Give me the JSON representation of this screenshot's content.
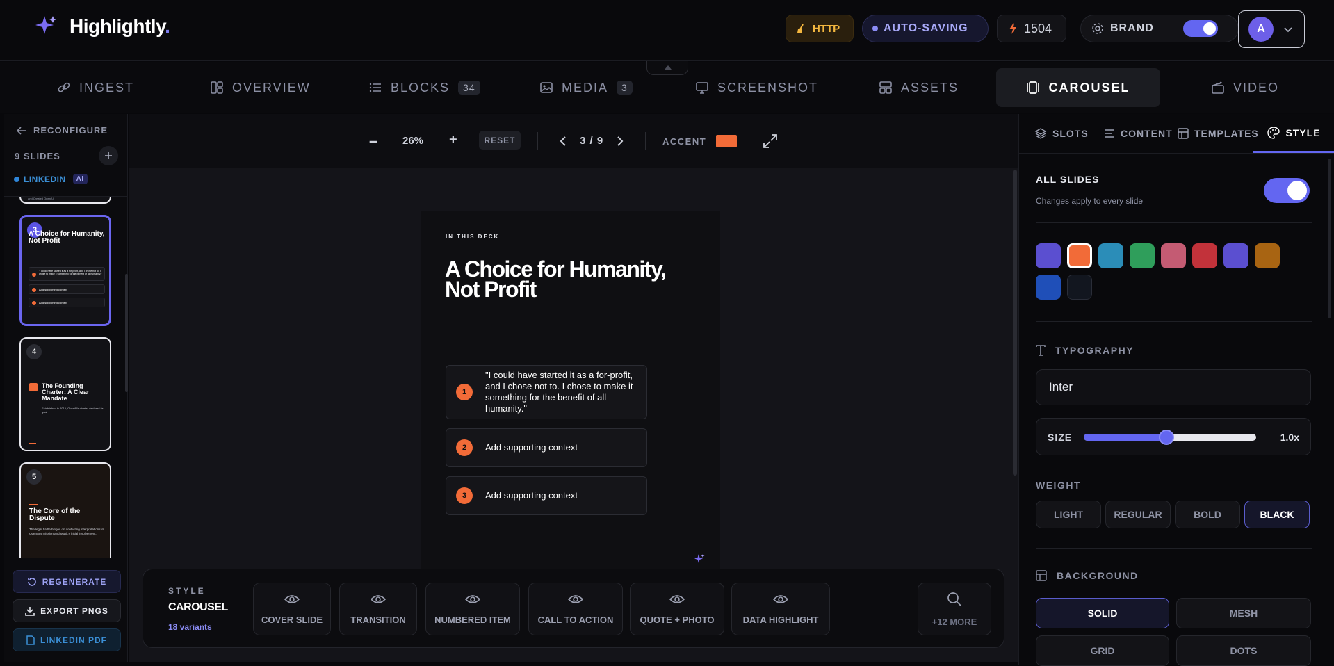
{
  "app": {
    "name": "Highlightly",
    "name_dot": "."
  },
  "header": {
    "http_label": "HTTP",
    "autosave_label": "AUTO-SAVING",
    "credits": "1504",
    "brand_label": "BRAND",
    "avatar_initial": "A",
    "colors": {
      "http": "#f4b73f",
      "autosave": "#8b8cf5",
      "accent": "#6366f1"
    }
  },
  "nav": {
    "tabs": [
      {
        "label": "INGEST",
        "badge": ""
      },
      {
        "label": "OVERVIEW",
        "badge": ""
      },
      {
        "label": "BLOCKS",
        "badge": "34"
      },
      {
        "label": "MEDIA",
        "badge": "3"
      },
      {
        "label": "SCREENSHOT",
        "badge": ""
      },
      {
        "label": "ASSETS",
        "badge": ""
      },
      {
        "label": "CAROUSEL",
        "badge": ""
      },
      {
        "label": "VIDEO",
        "badge": ""
      }
    ],
    "active": "CAROUSEL"
  },
  "sidebar": {
    "reconfigure": "RECONFIGURE",
    "slide_count": "9 SLIDES",
    "platform": "LINKEDIN",
    "ai_badge": "AI",
    "prev_slide_text": "and Created OpenAI",
    "thumbs": [
      {
        "num": "3",
        "title": "A Choice for Humanity, Not Profit",
        "items": [
          "\"I could have started it as a for-profit, and I chose not to. I chose to make it something for the benefit of all humanity.\"",
          "Add supporting context",
          "Add supporting context"
        ]
      },
      {
        "num": "4",
        "title": "The Founding Charter: A Clear Mandate",
        "body": "Established in 2015, OpenAI's charter declared its goal"
      },
      {
        "num": "5",
        "title": "The Core of the Dispute",
        "body": "The legal battle hinges on conflicting interpretations of OpenAI's mission and Musk's initial involvement."
      }
    ],
    "regenerate": "REGENERATE",
    "export": "EXPORT PNGS",
    "linkedin_pdf": "LINKEDIN PDF"
  },
  "canvas_toolbar": {
    "zoom_out": "–",
    "zoom": "26%",
    "zoom_in": "+",
    "reset": "RESET",
    "page": "3 / 9",
    "accent_label": "ACCENT",
    "accent_color": "#f26b38"
  },
  "slide": {
    "eyebrow": "IN THIS DECK",
    "title_line1": "A Choice for Humanity,",
    "title_line2": "Not Profit",
    "items": [
      {
        "num": "1",
        "text": "\"I could have started it as a for-profit, and I chose not to. I chose to make it something for the benefit of all humanity.\""
      },
      {
        "num": "2",
        "text": "Add supporting context"
      },
      {
        "num": "3",
        "text": "Add supporting context"
      }
    ]
  },
  "variants_bar": {
    "style_label": "STYLE",
    "style_name": "CAROUSEL",
    "variant_count": "18 variants",
    "variants": [
      "COVER SLIDE",
      "TRANSITION",
      "NUMBERED ITEM",
      "CALL TO ACTION",
      "QUOTE + PHOTO",
      "DATA HIGHLIGHT"
    ],
    "more": "+12 MORE"
  },
  "panel": {
    "tabs": [
      "SLOTS",
      "CONTENT",
      "TEMPLATES",
      "STYLE"
    ],
    "active_tab": "STYLE",
    "all_slides_title": "ALL SLIDES",
    "all_slides_sub": "Changes apply to every slide",
    "swatches": [
      "#5b4fd0",
      "#f26b38",
      "#2b8db8",
      "#2f9e5b",
      "#c45b73",
      "#c2323a",
      "#5b4fd0",
      "#a86412",
      "#1f4fb8",
      "#12161f"
    ],
    "selected_swatch": "#f26b38",
    "typography_label": "TYPOGRAPHY",
    "font": "Inter",
    "size_label": "SIZE",
    "size_value": "1.0x",
    "size_fraction": 0.48,
    "weight_label": "WEIGHT",
    "weights": [
      "LIGHT",
      "REGULAR",
      "BOLD",
      "BLACK"
    ],
    "weight_selected": "BLACK",
    "background_label": "BACKGROUND",
    "backgrounds": [
      "SOLID",
      "MESH",
      "GRID",
      "DOTS"
    ],
    "background_selected": "SOLID"
  }
}
